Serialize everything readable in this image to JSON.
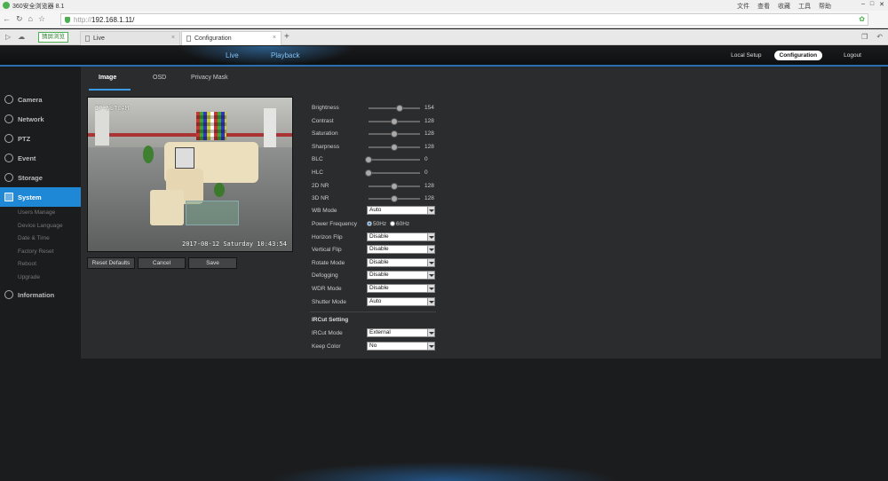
{
  "browser": {
    "title": "360安全浏览器 8.1",
    "menu": [
      "文件",
      "查看",
      "收藏",
      "工具",
      "帮助"
    ],
    "url_protocol": "http://",
    "url_host": "192.168.1.11/",
    "green_tab_label": "猜屏浏览",
    "tabs": [
      {
        "label": "Live",
        "active": false
      },
      {
        "label": "Configuration",
        "active": true
      }
    ]
  },
  "header": {
    "top_tabs": [
      "Live",
      "Playback"
    ],
    "right_links": [
      {
        "label": "Local Setup",
        "active": false
      },
      {
        "label": "Configuration",
        "active": true
      },
      {
        "label": "Logout",
        "active": false
      }
    ],
    "accent_color": "#1f88d6"
  },
  "sidebar": {
    "items": [
      {
        "label": "Camera",
        "icon": "camera-icon"
      },
      {
        "label": "Network",
        "icon": "network-icon"
      },
      {
        "label": "PTZ",
        "icon": "ptz-icon"
      },
      {
        "label": "Event",
        "icon": "event-icon"
      },
      {
        "label": "Storage",
        "icon": "storage-icon"
      },
      {
        "label": "System",
        "icon": "system-icon",
        "active": true
      },
      {
        "label": "Information",
        "icon": "information-icon"
      }
    ],
    "system_subitems": [
      "Users Manage",
      "Device Language",
      "Date & Time",
      "Factory Reset",
      "Reboot",
      "Upgrade"
    ]
  },
  "panel": {
    "tabs": [
      {
        "label": "Image",
        "active": true
      },
      {
        "label": "OSD",
        "active": false
      },
      {
        "label": "Privacy Mask",
        "active": false
      }
    ],
    "video": {
      "osd_name": "IP-NETCAM",
      "osd_time": "2017-08-12 Saturday 10:43:54"
    },
    "buttons": {
      "reset_defaults": "Reset Defaults",
      "cancel": "Cancel",
      "save": "Save"
    },
    "sliders": [
      {
        "label": "Brightness",
        "value": 154
      },
      {
        "label": "Contrast",
        "value": 128
      },
      {
        "label": "Saturation",
        "value": 128
      },
      {
        "label": "Sharpness",
        "value": 128
      },
      {
        "label": "BLC",
        "value": 0
      },
      {
        "label": "HLC",
        "value": 0
      },
      {
        "label": "2D NR",
        "value": 128
      },
      {
        "label": "3D NR",
        "value": 128
      }
    ],
    "wb_mode": {
      "label": "WB Mode",
      "value": "Auto"
    },
    "power_frequency": {
      "label": "Power Frequency",
      "options": [
        "50Hz",
        "60Hz"
      ],
      "selected": "50Hz"
    },
    "selects": [
      {
        "label": "Horizon Flip",
        "value": "Disable"
      },
      {
        "label": "Vertical Flip",
        "value": "Disable"
      },
      {
        "label": "Rotate Mode",
        "value": "Disable"
      },
      {
        "label": "Defogging",
        "value": "Disable"
      },
      {
        "label": "WDR Mode",
        "value": "Disable"
      },
      {
        "label": "Shutter Mode",
        "value": "Auto"
      }
    ],
    "ircut": {
      "heading": "IRCut Setting",
      "mode": {
        "label": "IRCut Mode",
        "value": "External"
      },
      "keep_color": {
        "label": "Keep Color",
        "value": "No"
      }
    }
  }
}
